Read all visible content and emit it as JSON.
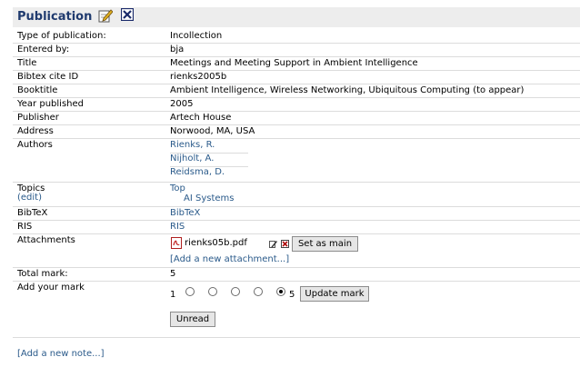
{
  "section_title": "Publication",
  "fields": {
    "type_label": "Type of publication:",
    "type_value": "Incollection",
    "entered_by_label": "Entered by:",
    "entered_by_value": "bja",
    "title_label": "Title",
    "title_value": "Meetings and Meeting Support in Ambient Intelligence",
    "bibtex_id_label": "Bibtex cite ID",
    "bibtex_id_value": "rienks2005b",
    "booktitle_label": "Booktitle",
    "booktitle_value": "Ambient Intelligence, Wireless Networking, Ubiquitous Computing (to appear)",
    "year_label": "Year published",
    "year_value": "2005",
    "publisher_label": "Publisher",
    "publisher_value": "Artech House",
    "address_label": "Address",
    "address_value": "Norwood, MA, USA",
    "authors_label": "Authors",
    "authors": [
      "Rienks, R.",
      "Nijholt, A.",
      "Reidsma, D."
    ],
    "topics_label": "Topics",
    "topics_edit": "(edit)",
    "topics_top": "Top",
    "topics_sub": "AI Systems",
    "bibtex_label": "BibTeX",
    "bibtex_link": "BibTeX",
    "ris_label": "RIS",
    "ris_link": "RIS",
    "attachments_label": "Attachments",
    "attachment_file": "rienks05b.pdf",
    "set_main_button": "Set as main",
    "add_attachment": "[Add a new attachment...]",
    "total_mark_label": "Total mark:",
    "total_mark_value": "5",
    "add_mark_label": "Add your mark",
    "mark_min": "1",
    "mark_max": "5",
    "mark_selected": 5,
    "update_mark_button": "Update mark",
    "unread_button": "Unread"
  },
  "add_note": "[Add a new note...]",
  "colors": {
    "link": "#2a5a8a",
    "title": "#1f3a6e",
    "header_bg": "#ededed"
  }
}
